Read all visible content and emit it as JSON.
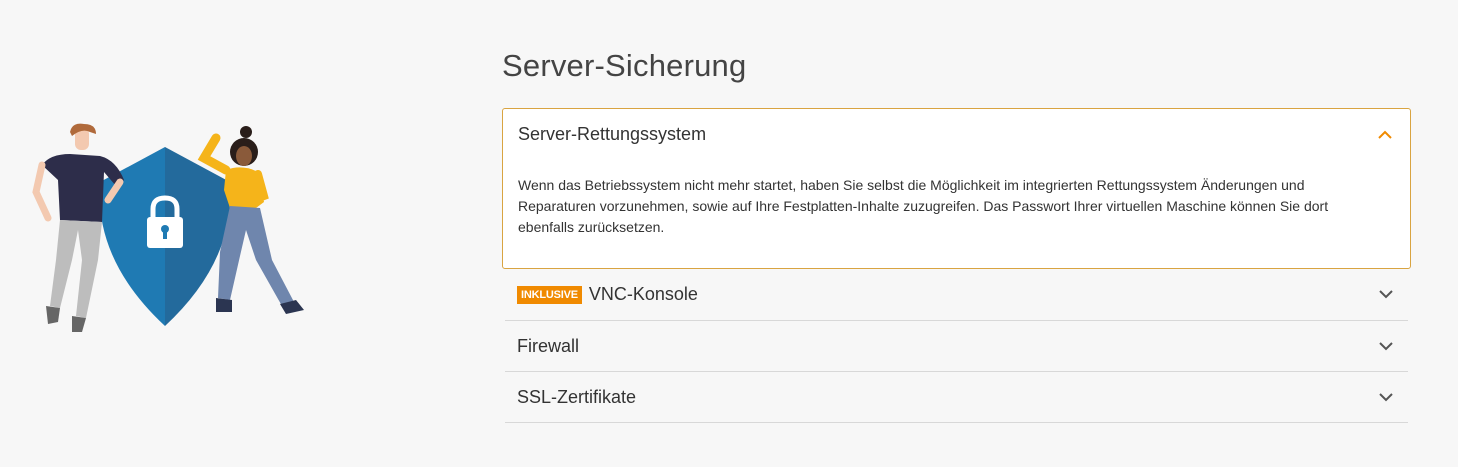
{
  "section": {
    "title": "Server-Sicherung"
  },
  "accordion": {
    "open_item": {
      "title": "Server-Rettungssystem",
      "body": "Wenn das Betriebssystem nicht mehr startet, haben Sie selbst die Möglichkeit im integrierten Rettungssystem Änderungen und Reparaturen vorzunehmen, sowie auf Ihre Festplatten-Inhalte zuzugreifen. Das Passwort Ihrer virtuellen Maschine können Sie dort ebenfalls zurücksetzen.",
      "icon": "chevron-up-icon"
    },
    "items": [
      {
        "badge": "INKLUSIVE",
        "title": "VNC-Konsole",
        "icon": "chevron-down-icon"
      },
      {
        "title": "Firewall",
        "icon": "chevron-down-icon"
      },
      {
        "title": "SSL-Zertifikate",
        "icon": "chevron-down-icon"
      }
    ]
  },
  "colors": {
    "accent": "#f08a00",
    "open_border": "#d9a441",
    "shield_light": "#1f7ab3",
    "shield_dark": "#236a9c"
  }
}
